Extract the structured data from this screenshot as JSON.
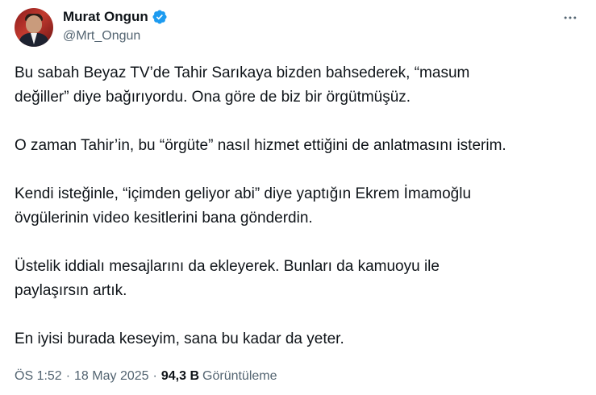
{
  "author": {
    "display_name": "Murat Ongun",
    "handle": "@Mrt_Ongun",
    "verified_icon": "verified-badge-icon",
    "verified_color": "#1d9bf0"
  },
  "tweet": {
    "paragraphs": [
      [
        "Bu sabah Beyaz TV’de Tahir Sarıkaya bizden bahsederek, “masum",
        "değiller” diye bağırıyordu. Ona göre de biz bir örgütmüşüz."
      ],
      [
        "O zaman Tahir’in, bu “örgüte” nasıl hizmet ettiğini de anlatmasını isterim."
      ],
      [
        "Kendi isteğinle, “içimden geliyor abi” diye yaptığın Ekrem İmamoğlu",
        "övgülerinin video kesitlerini bana gönderdin."
      ],
      [
        "Üstelik iddialı mesajlarını da ekleyerek. Bunları da kamuoyu ile",
        "paylaşırsın artık."
      ],
      [
        "En iyisi burada keseyim, sana bu kadar da yeter."
      ]
    ]
  },
  "meta": {
    "time": "ÖS 1:52",
    "separator": "·",
    "date": "18 May 2025",
    "views_count": "94,3 B",
    "views_label": "Görüntüleme"
  },
  "icons": {
    "more": "more-options-icon"
  },
  "colors": {
    "text": "#0f1419",
    "secondary": "#536471",
    "accent": "#1d9bf0"
  }
}
